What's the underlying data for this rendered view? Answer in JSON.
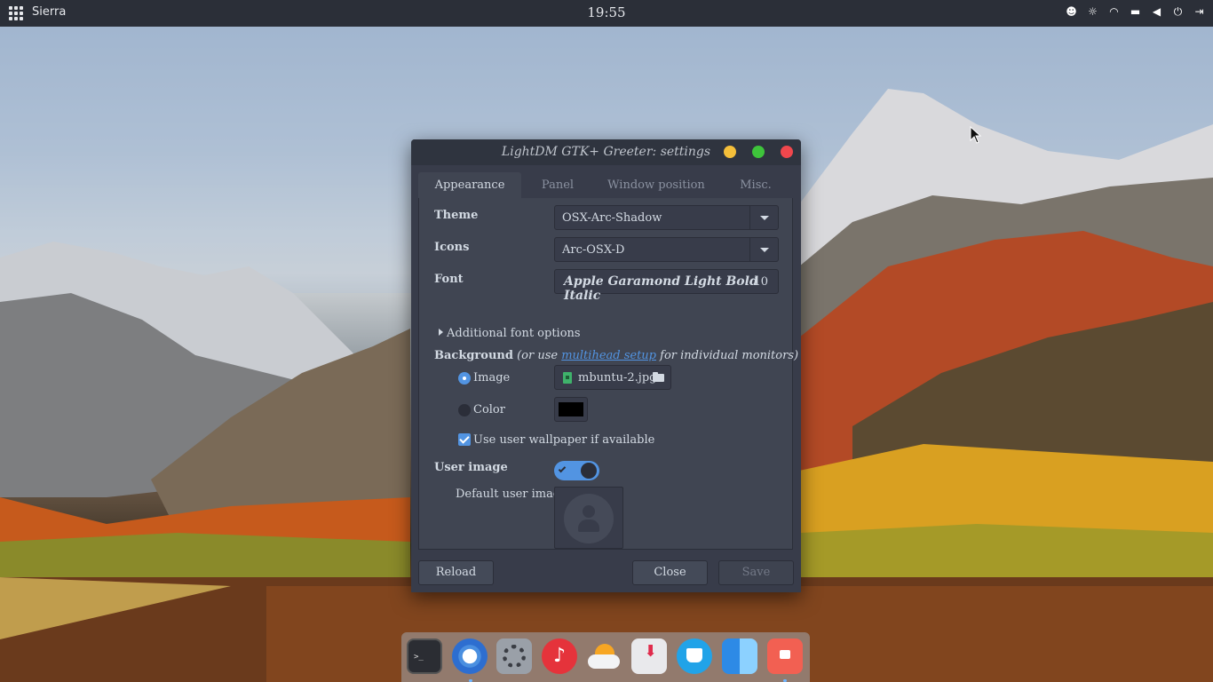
{
  "topbar": {
    "activities_label": "Sierra",
    "clock": "19:55",
    "tray_icons": [
      "face-icon",
      "brightness-icon",
      "wifi-icon",
      "battery-icon",
      "volume-icon",
      "power-menu-icon",
      "logout-icon"
    ]
  },
  "window": {
    "title": "LightDM GTK+ Greeter: settings",
    "tabs": [
      "Appearance",
      "Panel",
      "Window position",
      "Misc."
    ],
    "active_tab": "Appearance",
    "theme": {
      "label": "Theme",
      "value": "OSX-Arc-Shadow"
    },
    "icons": {
      "label": "Icons",
      "value": "Arc-OSX-D"
    },
    "font": {
      "label": "Font",
      "name": "Apple Garamond Light Bold Italic",
      "size": "10"
    },
    "additional_font_options": "Additional font options",
    "background": {
      "label": "Background",
      "hint_prefix": "(or use",
      "hint_link": "multihead setup",
      "hint_suffix": "for individual monitors)",
      "image_label": "Image",
      "image_file": "mbuntu-2.jpg",
      "color_label": "Color",
      "color_value": "#000000",
      "use_user_wallpaper": "Use user wallpaper if available",
      "image_selected": true,
      "use_user_wallpaper_checked": true
    },
    "user_image": {
      "label": "User image",
      "enabled": true,
      "default_label": "Default user image"
    },
    "buttons": {
      "reload": "Reload",
      "close": "Close",
      "save": "Save"
    }
  },
  "dock": {
    "items": [
      "terminal-icon",
      "chromium-icon",
      "system-settings-icon",
      "music-icon",
      "weather-icon",
      "installer-icon",
      "teapot-icon",
      "finder-icon",
      "keyring-icon"
    ]
  },
  "colors": {
    "accent": "#5294e2",
    "window_bg": "#383c4a",
    "titlebar_bg": "#2f343f",
    "topbar_bg": "#2b2f38"
  }
}
